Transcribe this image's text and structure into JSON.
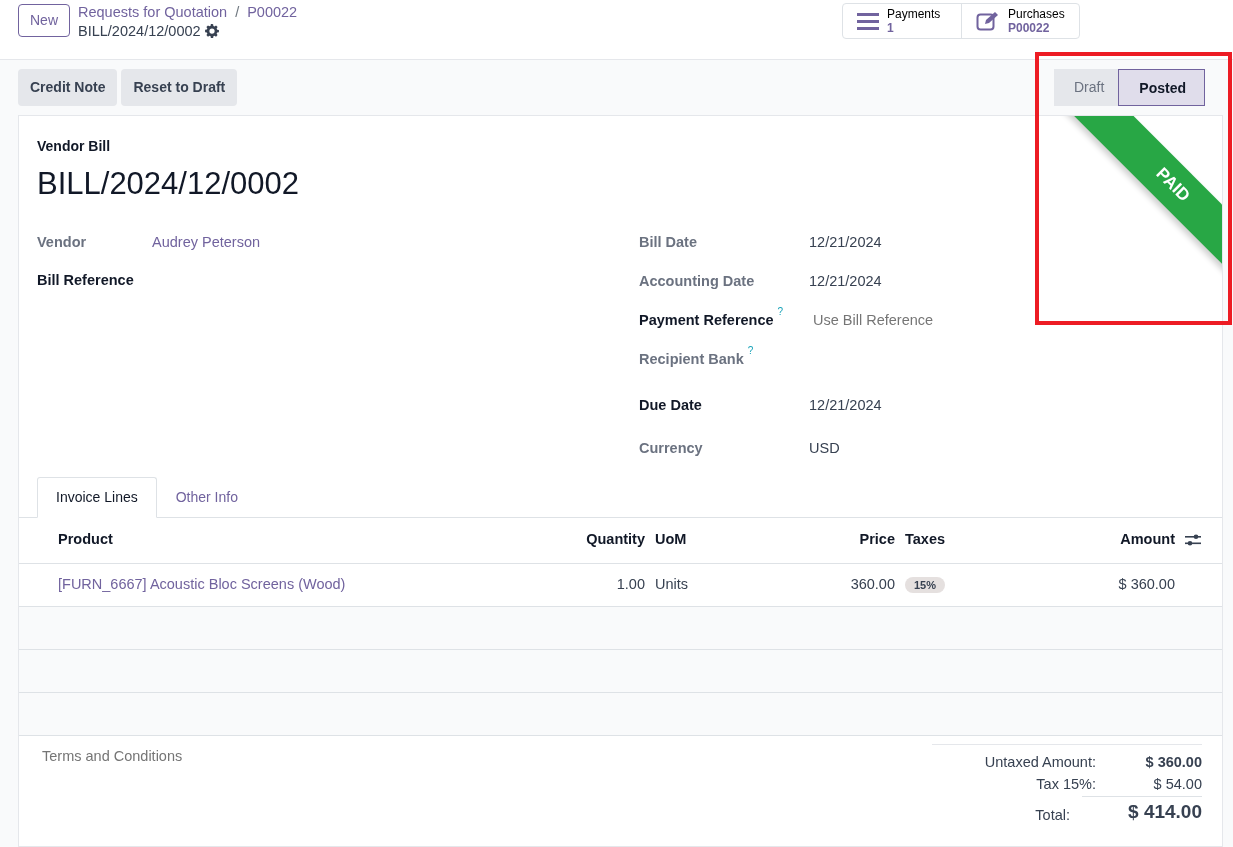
{
  "control_panel": {
    "new_button": "New",
    "breadcrumbs": [
      "Requests for Quotation",
      "P00022"
    ],
    "breadcrumb_separator": "/",
    "record_name": "BILL/2024/12/0002",
    "smart_buttons": [
      {
        "kind": "list",
        "label": "Payments",
        "value": "1"
      },
      {
        "kind": "edit",
        "label": "Purchases",
        "value": "P00022"
      }
    ]
  },
  "actions": [
    "Credit Note",
    "Reset to Draft"
  ],
  "status_stages": [
    {
      "label": "Draft",
      "selected": false
    },
    {
      "label": "Posted",
      "selected": true
    }
  ],
  "ribbon": {
    "text": "PAID"
  },
  "highlight_frame": {
    "shown": true
  },
  "sheet": {
    "type_label": "Vendor Bill",
    "title": "BILL/2024/12/0002",
    "left_fields": [
      {
        "label": "Vendor",
        "value": "Audrey Peterson",
        "required": false,
        "link": true
      },
      {
        "label": "Bill Reference",
        "required": true
      }
    ],
    "right_fields": [
      {
        "label": "Bill Date",
        "value": "12/21/2024",
        "required": false
      },
      {
        "label": "Accounting Date",
        "value": "12/21/2024",
        "required": false
      },
      {
        "label": "Payment Reference",
        "placeholder": "Use Bill Reference",
        "required": true,
        "help": "?"
      },
      {
        "label": "Recipient Bank",
        "required": false,
        "help": "?"
      },
      {
        "label": "Due Date",
        "value": "12/21/2024",
        "required": true
      },
      {
        "label": "Currency",
        "value": "USD",
        "required": false
      }
    ],
    "tabs": [
      {
        "label": "Invoice Lines",
        "selected": true
      },
      {
        "label": "Other Info",
        "selected": false
      }
    ],
    "table": {
      "columns": [
        "Product",
        "Quantity",
        "UoM",
        "Price",
        "Taxes",
        "Amount"
      ],
      "rows": [
        {
          "product": "[FURN_6667] Acoustic Bloc Screens (Wood)",
          "quantity": "1.00",
          "uom": "Units",
          "price": "360.00",
          "taxes": [
            "15%"
          ],
          "amount": "$ 360.00"
        }
      ]
    },
    "terms_placeholder": "Terms and Conditions",
    "totals": [
      {
        "label": "Untaxed Amount:",
        "value": "$ 360.00",
        "kind": "subtotal"
      },
      {
        "label": "Tax 15%:",
        "value": "$ 54.00",
        "kind": "tax"
      },
      {
        "label": "Total:",
        "value": "$ 414.00",
        "kind": "total"
      }
    ]
  }
}
